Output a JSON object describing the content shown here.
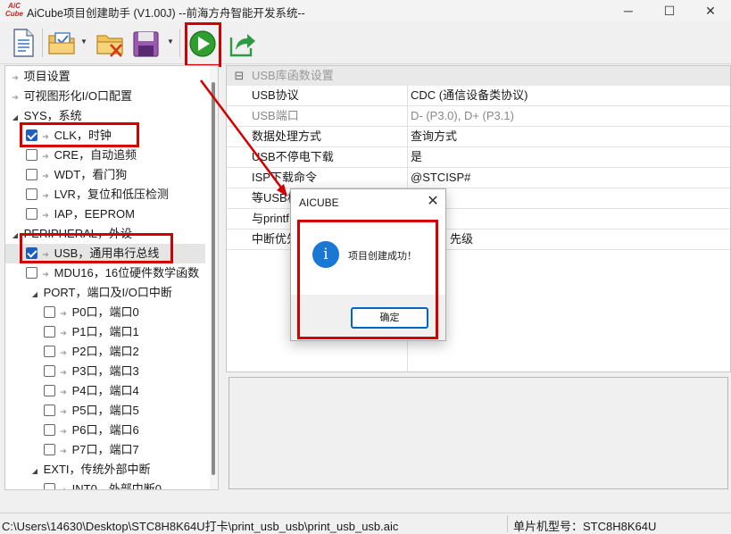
{
  "window": {
    "logo_text": "AiC\nCube",
    "title": "AiCube项目创建助手 (V1.00J) --前海方舟智能开发系统--",
    "controls": [
      "─",
      "☐",
      "✕"
    ]
  },
  "toolbar": {
    "buttons": [
      "new-project",
      "open-project",
      "close-project",
      "save-project",
      "run",
      "export"
    ]
  },
  "tree": {
    "items": [
      {
        "label": "项目设置"
      },
      {
        "label": "可视图形化I/O口配置"
      },
      {
        "label": "SYS，系统"
      },
      {
        "label": "CLK，时钟",
        "checked": true
      },
      {
        "label": "CRE，自动追频",
        "checked": false
      },
      {
        "label": "WDT，看门狗",
        "checked": false
      },
      {
        "label": "LVR，复位和低压检测",
        "checked": false
      },
      {
        "label": "IAP，EEPROM",
        "checked": false
      },
      {
        "label": "PERIPHERAL，外设"
      },
      {
        "label": "USB，通用串行总线",
        "checked": true
      },
      {
        "label": "MDU16，16位硬件数学函数",
        "checked": false
      },
      {
        "label": "PORT，端口及I/O口中断"
      },
      {
        "label": "P0口，端口0",
        "checked": false
      },
      {
        "label": "P1口，端口1",
        "checked": false
      },
      {
        "label": "P2口，端口2",
        "checked": false
      },
      {
        "label": "P3口，端口3",
        "checked": false
      },
      {
        "label": "P4口，端口4",
        "checked": false
      },
      {
        "label": "P5口，端口5",
        "checked": false
      },
      {
        "label": "P6口，端口6",
        "checked": false
      },
      {
        "label": "P7口，端口7",
        "checked": false
      },
      {
        "label": "EXTI，传统外部中断"
      },
      {
        "label": "INT0，外部中断0",
        "checked": false
      }
    ]
  },
  "props": {
    "section": "USB库函数设置",
    "collapse_glyph": "⊟",
    "rows": [
      {
        "name": "USB协议",
        "value": "CDC (通信设备类协议)"
      },
      {
        "name": "USB端口",
        "value": "D- (P3.0), D+ (P3.1)"
      },
      {
        "name": "数据处理方式",
        "value": "查询方式"
      },
      {
        "name": "USB不停电下载",
        "value": "是"
      },
      {
        "name": "ISP下载命令",
        "value": "@STCISP#"
      },
      {
        "name": "等USB枚举",
        "value": ""
      },
      {
        "name": "与printf",
        "value": ""
      },
      {
        "name": "中断优先级",
        "value": "先级"
      }
    ]
  },
  "dialog": {
    "title": "AICUBE",
    "close": "✕",
    "icon_glyph": "i",
    "message": "项目创建成功！",
    "ok_label": "确定"
  },
  "statusbar": {
    "path": "C:\\Users\\14630\\Desktop\\STC8H8K64U打卡\\print_usb_usb\\print_usb_usb.aic",
    "chip": "单片机型号：STC8H8K64U"
  },
  "colors": {
    "highlight": "#d40000",
    "checkbox_on": "#1d5fbf",
    "info_icon": "#1a78d4",
    "run_button": "#2e9e2e"
  }
}
